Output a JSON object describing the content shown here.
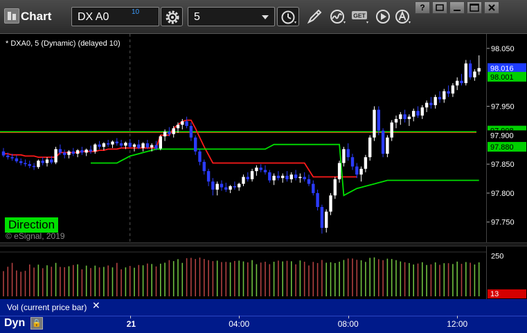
{
  "window": {
    "title": "Chart",
    "symbol": "DX A0",
    "link_number": "10",
    "interval": "5",
    "buttons": {
      "help": "?",
      "restore": "",
      "minimize": "",
      "maximize": "",
      "close": ""
    }
  },
  "legend": {
    "study": "* DXA0, 5 (Dynamic) (delayed 10)",
    "direction": "Direction",
    "copyright": "© eSignal, 2019",
    "volume": "Vol (current price bar)"
  },
  "footer": {
    "mode": "Dyn"
  },
  "colors": {
    "up_candle": "#ffffff",
    "down_candle": "#2b3cff",
    "red_line": "#ff1a1a",
    "green_line": "#00e000",
    "volume_up": "#6fbf3f",
    "volume_down": "#b04040",
    "axis_bg": "#001a8a",
    "last_price_tag": "#1e3cff",
    "green_tag": "#00d000",
    "volume_tag": "#d40000"
  },
  "chart_data": {
    "type": "candlestick",
    "y_range": [
      97.715,
      98.075
    ],
    "y_ticks": [
      {
        "value": 98.05,
        "label": "98.050"
      },
      {
        "value": 97.95,
        "label": "97.950"
      },
      {
        "value": 97.85,
        "label": "97.850"
      },
      {
        "value": 97.8,
        "label": "97.800"
      },
      {
        "value": 97.75,
        "label": "97.750"
      }
    ],
    "price_tags": [
      {
        "value": 98.016,
        "label": "98.016",
        "color": "#1e3cff"
      },
      {
        "value": 98.001,
        "label": "98.001",
        "color": "#00d000"
      },
      {
        "value": 97.908,
        "label": "97.908",
        "color": "#00d000"
      },
      {
        "value": 97.9,
        "label": "97.900",
        "color": "#000000"
      },
      {
        "value": 97.88,
        "label": "97.880",
        "color": "#00d000"
      }
    ],
    "time_labels": [
      {
        "label": "21",
        "bar": 29,
        "bold": true
      },
      {
        "label": "04:00",
        "bar": 54,
        "bold": false
      },
      {
        "label": "08:00",
        "bar": 79,
        "bold": false
      },
      {
        "label": "12:00",
        "bar": 104,
        "bold": false
      }
    ],
    "volume_axis": {
      "max": 300,
      "tick": {
        "value": 250,
        "label": "250"
      },
      "last": {
        "value": 13,
        "label": "13"
      }
    },
    "horizontal_lines": [
      {
        "name": "red-level",
        "value": 97.905,
        "color": "#ff1a1a"
      },
      {
        "name": "green-level",
        "value": 97.906,
        "color": "#00e000"
      }
    ],
    "candles": [
      [
        97.872,
        97.878,
        97.862,
        97.865
      ],
      [
        97.865,
        97.87,
        97.858,
        97.862
      ],
      [
        97.862,
        97.868,
        97.856,
        97.86
      ],
      [
        97.86,
        97.866,
        97.852,
        97.855
      ],
      [
        97.855,
        97.86,
        97.848,
        97.852
      ],
      [
        97.852,
        97.858,
        97.846,
        97.85
      ],
      [
        97.85,
        97.856,
        97.843,
        97.847
      ],
      [
        97.847,
        97.852,
        97.84,
        97.845
      ],
      [
        97.845,
        97.858,
        97.842,
        97.856
      ],
      [
        97.856,
        97.862,
        97.848,
        97.852
      ],
      [
        97.852,
        97.862,
        97.846,
        97.858
      ],
      [
        97.858,
        97.864,
        97.85,
        97.853
      ],
      [
        97.853,
        97.88,
        97.85,
        97.876
      ],
      [
        97.876,
        97.884,
        97.866,
        97.87
      ],
      [
        97.87,
        97.875,
        97.86,
        97.866
      ],
      [
        97.866,
        97.874,
        97.86,
        97.872
      ],
      [
        97.872,
        97.878,
        97.864,
        97.868
      ],
      [
        97.868,
        97.876,
        97.862,
        97.874
      ],
      [
        97.874,
        97.88,
        97.866,
        97.87
      ],
      [
        97.87,
        97.877,
        97.864,
        97.875
      ],
      [
        97.875,
        97.882,
        97.868,
        97.872
      ],
      [
        97.872,
        97.886,
        97.868,
        97.884
      ],
      [
        97.884,
        97.89,
        97.876,
        97.88
      ],
      [
        97.88,
        97.888,
        97.874,
        97.886
      ],
      [
        97.886,
        97.892,
        97.88,
        97.884
      ],
      [
        97.884,
        97.891,
        97.878,
        97.889
      ],
      [
        97.889,
        97.895,
        97.882,
        97.886
      ],
      [
        97.886,
        97.892,
        97.878,
        97.882
      ],
      [
        97.882,
        97.889,
        97.876,
        97.887
      ],
      [
        97.887,
        97.893,
        97.878,
        97.88
      ],
      [
        97.88,
        97.886,
        97.872,
        97.884
      ],
      [
        97.884,
        97.892,
        97.876,
        97.878
      ],
      [
        97.878,
        97.888,
        97.872,
        97.886
      ],
      [
        97.886,
        97.892,
        97.876,
        97.879
      ],
      [
        97.879,
        97.886,
        97.872,
        97.883
      ],
      [
        97.883,
        97.89,
        97.874,
        97.877
      ],
      [
        97.877,
        97.9,
        97.874,
        97.898
      ],
      [
        97.898,
        97.91,
        97.89,
        97.906
      ],
      [
        97.906,
        97.914,
        97.898,
        97.902
      ],
      [
        97.902,
        97.916,
        97.896,
        97.912
      ],
      [
        97.912,
        97.922,
        97.904,
        97.918
      ],
      [
        97.918,
        97.928,
        97.91,
        97.924
      ],
      [
        97.924,
        97.932,
        97.912,
        97.916
      ],
      [
        97.916,
        97.922,
        97.89,
        97.896
      ],
      [
        97.896,
        97.9,
        97.866,
        97.872
      ],
      [
        97.872,
        97.876,
        97.848,
        97.854
      ],
      [
        97.854,
        97.858,
        97.832,
        97.838
      ],
      [
        97.838,
        97.842,
        97.812,
        97.82
      ],
      [
        97.82,
        97.826,
        97.796,
        97.806
      ],
      [
        97.806,
        97.82,
        97.796,
        97.816
      ],
      [
        97.816,
        97.822,
        97.804,
        97.81
      ],
      [
        97.81,
        97.818,
        97.802,
        97.806
      ],
      [
        97.806,
        97.814,
        97.8,
        97.812
      ],
      [
        97.812,
        97.82,
        97.806,
        97.81
      ],
      [
        97.81,
        97.818,
        97.804,
        97.816
      ],
      [
        97.816,
        97.832,
        97.812,
        97.828
      ],
      [
        97.828,
        97.836,
        97.82,
        97.824
      ],
      [
        97.824,
        97.842,
        97.82,
        97.838
      ],
      [
        97.838,
        97.848,
        97.83,
        97.844
      ],
      [
        97.844,
        97.85,
        97.836,
        97.84
      ],
      [
        97.84,
        97.848,
        97.832,
        97.836
      ],
      [
        97.836,
        97.84,
        97.818,
        97.822
      ],
      [
        97.822,
        97.834,
        97.814,
        97.83
      ],
      [
        97.83,
        97.838,
        97.822,
        97.826
      ],
      [
        97.826,
        97.834,
        97.818,
        97.83
      ],
      [
        97.83,
        97.838,
        97.82,
        97.824
      ],
      [
        97.824,
        97.836,
        97.818,
        97.832
      ],
      [
        97.832,
        97.84,
        97.822,
        97.826
      ],
      [
        97.826,
        97.834,
        97.818,
        97.828
      ],
      [
        97.828,
        97.836,
        97.82,
        97.824
      ],
      [
        97.824,
        97.832,
        97.812,
        97.816
      ],
      [
        97.816,
        97.822,
        97.796,
        97.8
      ],
      [
        97.8,
        97.806,
        97.77,
        97.776
      ],
      [
        97.776,
        97.78,
        97.73,
        97.74
      ],
      [
        97.74,
        97.772,
        97.732,
        97.768
      ],
      [
        97.768,
        97.8,
        97.762,
        97.796
      ],
      [
        97.796,
        97.828,
        97.79,
        97.824
      ],
      [
        97.824,
        97.856,
        97.818,
        97.852
      ],
      [
        97.852,
        97.88,
        97.846,
        97.876
      ],
      [
        97.876,
        97.886,
        97.856,
        97.862
      ],
      [
        97.862,
        97.868,
        97.84,
        97.846
      ],
      [
        97.846,
        97.852,
        97.826,
        97.832
      ],
      [
        97.832,
        97.846,
        97.82,
        97.842
      ],
      [
        97.842,
        97.866,
        97.836,
        97.862
      ],
      [
        97.862,
        97.9,
        97.856,
        97.896
      ],
      [
        97.896,
        97.95,
        97.89,
        97.944
      ],
      [
        97.944,
        97.95,
        97.9,
        97.908
      ],
      [
        97.908,
        97.912,
        97.862,
        97.868
      ],
      [
        97.868,
        97.9,
        97.862,
        97.896
      ],
      [
        97.896,
        97.926,
        97.89,
        97.922
      ],
      [
        97.922,
        97.934,
        97.912,
        97.928
      ],
      [
        97.928,
        97.94,
        97.918,
        97.936
      ],
      [
        97.936,
        97.944,
        97.922,
        97.928
      ],
      [
        97.928,
        97.936,
        97.916,
        97.932
      ],
      [
        97.932,
        97.946,
        97.924,
        97.942
      ],
      [
        97.942,
        97.95,
        97.93,
        97.934
      ],
      [
        97.934,
        97.952,
        97.928,
        97.948
      ],
      [
        97.948,
        97.96,
        97.94,
        97.956
      ],
      [
        97.956,
        97.966,
        97.946,
        97.952
      ],
      [
        97.952,
        97.97,
        97.946,
        97.966
      ],
      [
        97.966,
        97.976,
        97.956,
        97.962
      ],
      [
        97.962,
        97.98,
        97.956,
        97.976
      ],
      [
        97.976,
        97.986,
        97.966,
        97.972
      ],
      [
        97.972,
        97.99,
        97.966,
        97.986
      ],
      [
        97.986,
        98.0,
        97.978,
        97.994
      ],
      [
        97.994,
        98.006,
        97.986,
        97.99
      ],
      [
        97.99,
        98.03,
        97.986,
        98.024
      ],
      [
        98.024,
        98.03,
        97.996,
        98.0
      ],
      [
        98.0,
        98.014,
        97.994,
        98.01
      ],
      [
        98.01,
        98.038,
        98.004,
        98.016
      ]
    ],
    "red_line": [
      97.868,
      97.868,
      97.866,
      97.866,
      97.866,
      97.864,
      97.864,
      97.864,
      97.862,
      97.862,
      97.862,
      97.862,
      97.862,
      97.87,
      97.87,
      97.87,
      97.87,
      97.87,
      97.872,
      97.872,
      97.872,
      97.872,
      97.874,
      97.874,
      97.876,
      97.876,
      97.876,
      97.878,
      97.878,
      97.878,
      97.878,
      97.878,
      97.878,
      97.878,
      97.878,
      97.878,
      97.9,
      97.9,
      97.9,
      97.912,
      97.918,
      97.924,
      97.926,
      97.926,
      97.912,
      97.896,
      97.88,
      97.866,
      97.852,
      97.852,
      97.852,
      97.852,
      97.852,
      97.852,
      97.852,
      97.852,
      97.852,
      97.852,
      97.852,
      97.852,
      97.852,
      97.852,
      97.852,
      97.852,
      97.852,
      97.852,
      97.852,
      97.852,
      97.852,
      97.852,
      97.84,
      97.828,
      97.828,
      97.828,
      97.828,
      97.828,
      97.828,
      97.828,
      97.828,
      97.828,
      97.828,
      97.828
    ],
    "green_line": [
      97.852,
      97.852,
      97.852,
      97.852,
      97.852,
      97.852,
      97.852,
      97.856,
      97.86,
      97.864,
      97.866,
      97.868,
      97.87,
      97.872,
      97.874,
      97.876,
      97.876,
      97.876,
      97.876,
      97.876,
      97.876,
      97.876,
      97.876,
      97.876,
      97.876,
      97.876,
      97.876,
      97.876,
      97.876,
      97.876,
      97.876,
      97.876,
      97.876,
      97.876,
      97.876,
      97.876,
      97.876,
      97.876,
      97.876,
      97.876,
      97.876,
      97.88,
      97.884,
      97.884,
      97.884,
      97.884,
      97.884,
      97.884,
      97.884,
      97.884,
      97.884,
      97.884,
      97.884,
      97.884,
      97.884,
      97.884,
      97.884,
      97.884,
      97.796,
      97.8,
      97.804,
      97.808,
      97.81,
      97.812,
      97.814,
      97.816,
      97.818,
      97.82,
      97.822,
      97.822,
      97.822,
      97.822,
      97.822,
      97.822,
      97.822,
      97.822,
      97.822,
      97.822,
      97.822,
      97.822,
      97.822,
      97.822,
      97.822,
      97.822,
      97.822,
      97.822,
      97.822,
      97.822,
      97.822,
      97.822
    ],
    "volume": [
      156,
      183,
      207,
      160,
      152,
      158,
      197,
      178,
      196,
      174,
      192,
      183,
      207,
      182,
      180,
      186,
      194,
      198,
      167,
      190,
      175,
      190,
      179,
      182,
      191,
      179,
      207,
      167,
      179,
      188,
      177,
      194,
      192,
      203,
      200,
      185,
      202,
      208,
      224,
      218,
      230,
      207,
      236,
      238,
      231,
      240,
      231,
      224,
      218,
      221,
      212,
      213,
      210,
      219,
      221,
      216,
      210,
      224,
      199,
      209,
      214,
      199,
      214,
      221,
      216,
      220,
      217,
      198,
      222,
      214,
      191,
      213,
      206,
      225,
      208,
      211,
      206,
      214,
      225,
      234,
      234,
      226,
      223,
      213,
      238,
      241,
      230,
      224,
      233,
      231,
      224,
      216,
      211,
      206,
      197,
      203,
      211,
      194,
      198,
      210,
      195,
      205,
      205,
      200,
      215,
      201,
      212,
      208,
      197,
      210
    ]
  }
}
